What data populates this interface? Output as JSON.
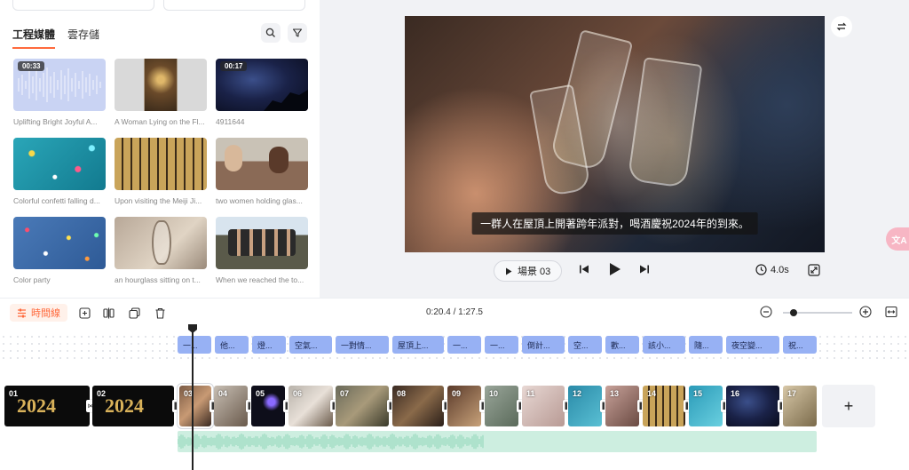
{
  "media_panel": {
    "tabs": [
      {
        "label": "工程媒體",
        "active": true
      },
      {
        "label": "雲存儲",
        "active": false
      }
    ],
    "items": [
      {
        "caption": "Uplifting Bright Joyful A...",
        "duration": "00:33",
        "kind": "audio"
      },
      {
        "caption": "A Woman Lying on the Fl...",
        "duration": "",
        "kind": "image"
      },
      {
        "caption": "4911644",
        "duration": "00:17",
        "kind": "video"
      },
      {
        "caption": "Colorful confetti falling d...",
        "duration": "",
        "kind": "image"
      },
      {
        "caption": "Upon visiting the Meiji Ji...",
        "duration": "",
        "kind": "image"
      },
      {
        "caption": "two women holding glas...",
        "duration": "",
        "kind": "image"
      },
      {
        "caption": "Color party",
        "duration": "",
        "kind": "image"
      },
      {
        "caption": "an hourglass sitting on t...",
        "duration": "",
        "kind": "image"
      },
      {
        "caption": "When we reached the to...",
        "duration": "",
        "kind": "image"
      }
    ]
  },
  "preview": {
    "subtitle": "一群人在屋頂上開著跨年派對，喝酒慶祝2024年的到來。",
    "scene_label": "場景 03",
    "duration": "4.0s",
    "translate_badge": "文A"
  },
  "timeline": {
    "label": "時間線",
    "time_readout": "0:20.4 / 1:27.5",
    "zoom_fraction": 0.15,
    "subtitles": [
      "一...",
      "他...",
      "燈...",
      "空氣...",
      "一對情...",
      "屋頂上...",
      "一...",
      "一...",
      "倒計...",
      "空...",
      "歡...",
      "該小...",
      "隨...",
      "夜空變...",
      "祝..."
    ],
    "clips": [
      "01",
      "02",
      "03",
      "04",
      "05",
      "06",
      "07",
      "08",
      "09",
      "10",
      "11",
      "12",
      "13",
      "14",
      "15",
      "16",
      "17"
    ],
    "add_label": "+"
  },
  "colors": {
    "accent": "#ff6a3d",
    "subtitle_chip": "#97b1f4",
    "audio_track": "#cdeee0"
  }
}
